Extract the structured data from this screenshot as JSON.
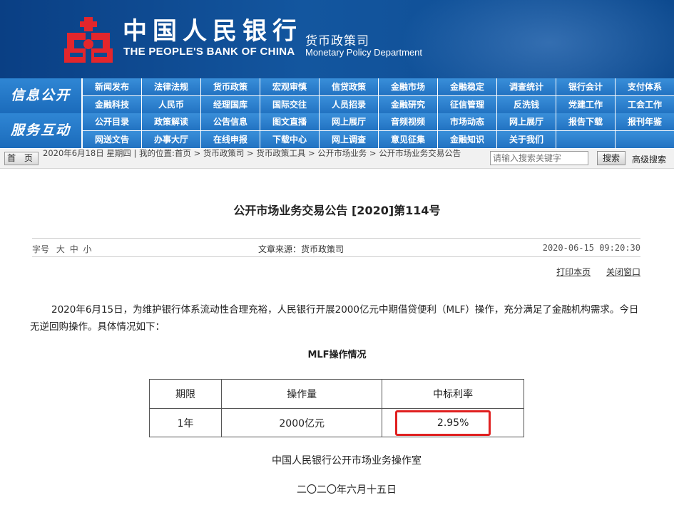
{
  "header": {
    "bank_name_cn": "中国人民银行",
    "bank_name_en": "THE PEOPLE'S BANK OF CHINA",
    "dept_cn": "货币政策司",
    "dept_en": "Monetary Policy Department",
    "logo_color": "#e3262c",
    "banner_color": "#0d4a8f"
  },
  "nav": {
    "section1_label": "信息公开",
    "section1_items": [
      "新闻发布",
      "法律法规",
      "货币政策",
      "宏观审慎",
      "信贷政策",
      "金融市场",
      "金融稳定",
      "调查统计",
      "银行会计",
      "支付体系",
      "金融科技",
      "人民币",
      "经理国库",
      "国际交往",
      "人员招录",
      "金融研究",
      "征信管理",
      "反洗钱",
      "党建工作",
      "工会工作"
    ],
    "section2_label": "服务互动",
    "section2_items": [
      "公开目录",
      "政策解读",
      "公告信息",
      "图文直播",
      "网上展厅",
      "音频视频",
      "市场动态",
      "网上展厅",
      "报告下载",
      "报刊年鉴",
      "网送文告",
      "办事大厅",
      "在线申报",
      "下载中心",
      "网上调查",
      "意见征集",
      "金融知识",
      "关于我们",
      "",
      ""
    ]
  },
  "locbar": {
    "home_label": "首 页",
    "location": "2020年6月18日 星期四 | 我的位置:首页 > 货币政策司 > 货币政策工具 > 公开市场业务 > 公开市场业务交易公告",
    "search_placeholder": "请输入搜索关键字",
    "search_button": "搜索",
    "advanced_search": "高级搜索"
  },
  "article": {
    "title": "公开市场业务交易公告 [2020]第114号",
    "font_size_label": "字号",
    "font_sizes": [
      "大",
      "中",
      "小"
    ],
    "source": "文章来源：货币政策司",
    "datetime": "2020-06-15 09:20:30",
    "print_label": "打印本页",
    "close_label": "关闭窗口",
    "paragraph": "2020年6月15日，为维护银行体系流动性合理充裕，人民银行开展2000亿元中期借贷便利（MLF）操作，充分满足了金融机构需求。今日无逆回购操作。具体情况如下：",
    "table_title": "MLF操作情况",
    "table": {
      "headers": [
        "期限",
        "操作量",
        "中标利率"
      ],
      "rows": [
        [
          "1年",
          "2000亿元",
          "2.95%"
        ]
      ]
    },
    "signature_org": "中国人民银行公开市场业务操作室",
    "signature_date": "二〇二〇年六月十五日",
    "highlight_color": "#e02020"
  }
}
